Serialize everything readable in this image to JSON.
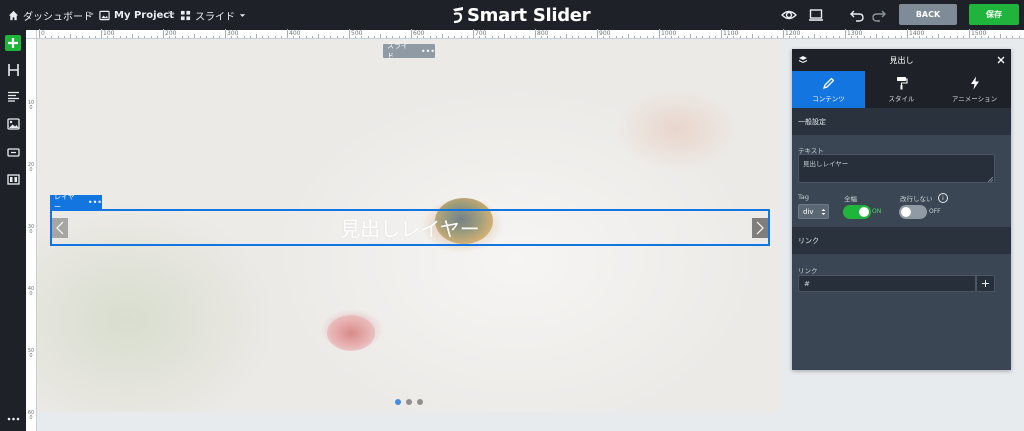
{
  "topbar": {
    "breadcrumbs": [
      {
        "label": "ダッシュボード",
        "icon": "home-icon"
      },
      {
        "label": "My Project",
        "icon": "image-icon"
      },
      {
        "label": "スライド",
        "icon": "grid-icon"
      }
    ],
    "separator": ">",
    "logo_text": "Smart Slider",
    "back_label": "BACK",
    "save_label": "保存"
  },
  "ruler": {
    "top_labels": [
      "0",
      "100",
      "200",
      "300",
      "400",
      "500",
      "600",
      "700",
      "800",
      "900",
      "1000",
      "1100",
      "1200",
      "1300",
      "1400",
      "1500"
    ],
    "left_labels": [
      "100",
      "200",
      "300",
      "400",
      "500",
      "600"
    ]
  },
  "canvas": {
    "slide_tag": "スライド",
    "layer_tag": "レイヤー",
    "more_dots": "•••",
    "layer_text": "見出しレイヤー",
    "bullets": [
      true,
      false,
      false
    ]
  },
  "panel": {
    "title": "見出し",
    "tabs": [
      {
        "label": "コンテンツ",
        "icon": "pencil-icon"
      },
      {
        "label": "スタイル",
        "icon": "paint-roller-icon"
      },
      {
        "label": "アニメーション",
        "icon": "bolt-icon"
      }
    ],
    "general_section": "一般設定",
    "text_label": "テキスト",
    "text_value": "見出しレイヤー",
    "tag_label": "Tag",
    "tag_value": "div",
    "fullwidth_label": "全幅",
    "fullwidth_state": "ON",
    "nowrap_label": "改行しない",
    "nowrap_state": "OFF",
    "link_section": "リンク",
    "link_label": "リンク",
    "link_value": "#",
    "link_add": "+"
  },
  "colors": {
    "accent": "#1375e0",
    "save": "#1fb53c",
    "toggle_on": "#1fb53c",
    "panel_bg": "#3a4653"
  }
}
